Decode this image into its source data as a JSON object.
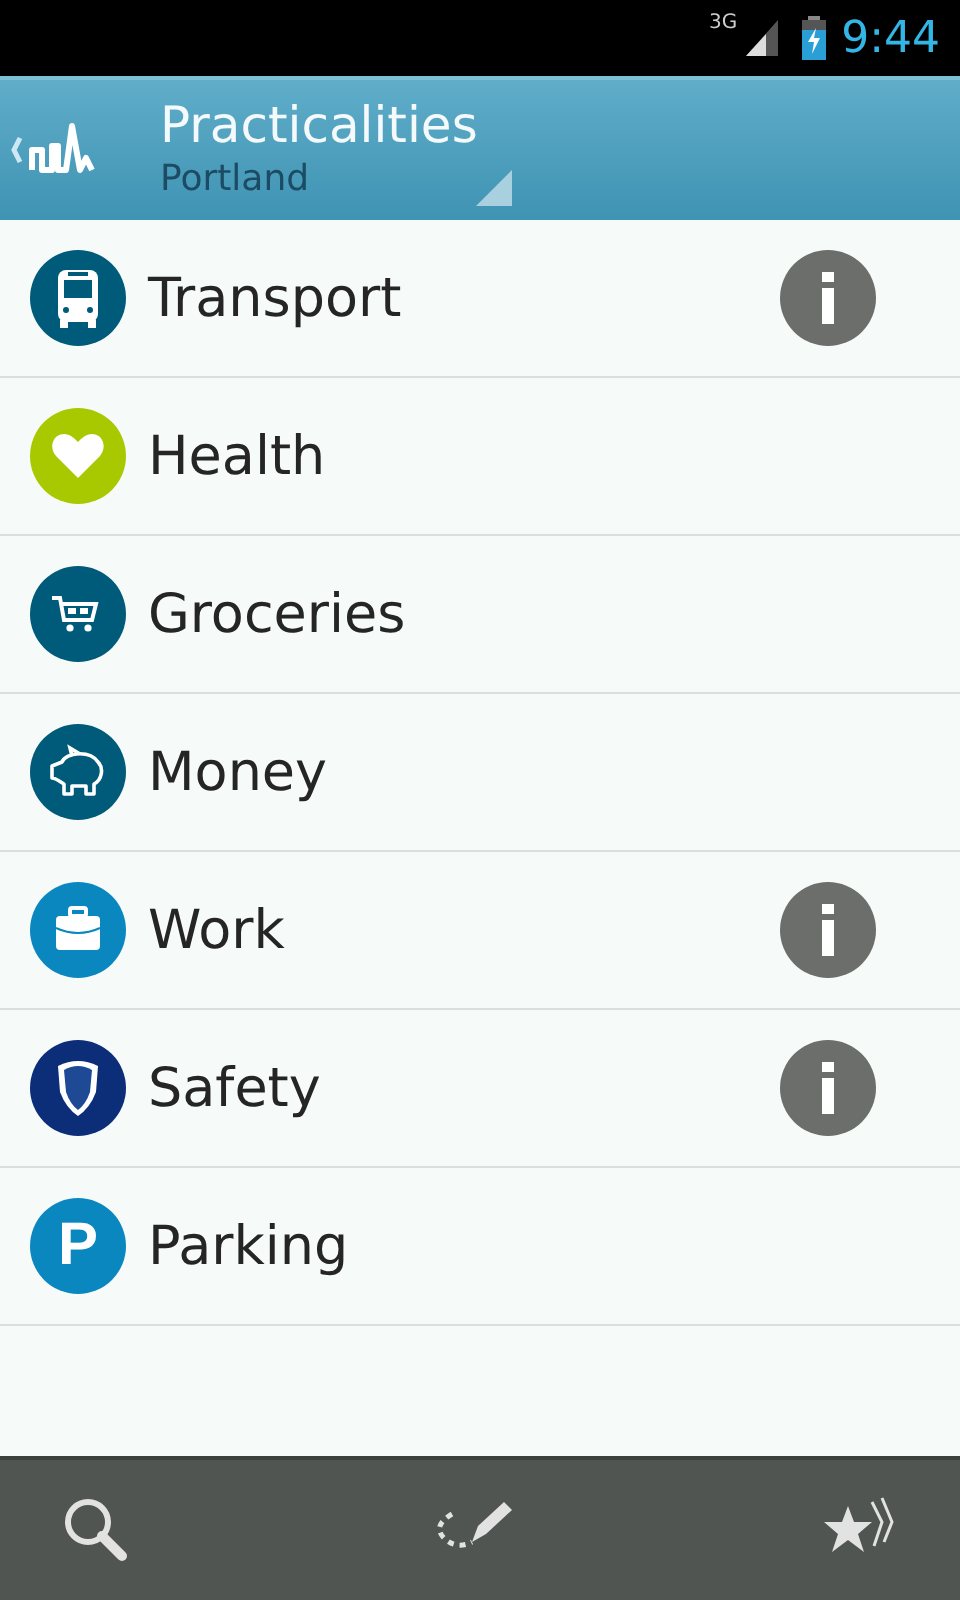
{
  "status_bar": {
    "network": "3G",
    "time": "9:44"
  },
  "header": {
    "title": "Practicalities",
    "subtitle": "Portland"
  },
  "items": [
    {
      "label": "Transport",
      "kind": "bus",
      "color": "#005a7a",
      "info": true
    },
    {
      "label": "Health",
      "kind": "heart",
      "color": "#a8c800",
      "info": false
    },
    {
      "label": "Groceries",
      "kind": "cart",
      "color": "#005a7a",
      "info": false
    },
    {
      "label": "Money",
      "kind": "piggy",
      "color": "#005a7a",
      "info": false
    },
    {
      "label": "Work",
      "kind": "briefcase",
      "color": "#0a87bf",
      "info": true
    },
    {
      "label": "Safety",
      "kind": "shield",
      "color": "#0c2e78",
      "info": true
    },
    {
      "label": "Parking",
      "kind": "parking",
      "color": "#0a87bf",
      "info": false,
      "symbol": "P"
    }
  ]
}
